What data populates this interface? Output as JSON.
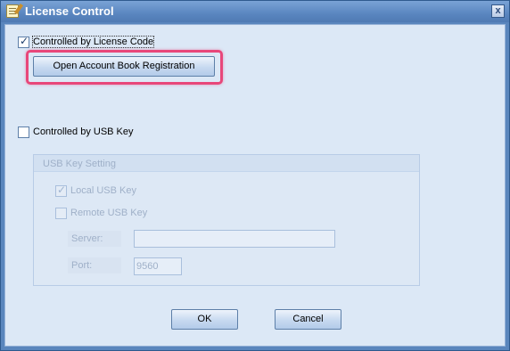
{
  "window": {
    "title": "License Control",
    "close_glyph": "x"
  },
  "license_code": {
    "checkbox_label": "Controlled by License Code",
    "checked": true,
    "register_button": "Open Account Book Registration"
  },
  "usb_key": {
    "checkbox_label": "Controlled by USB Key",
    "checked": false,
    "group_title": "USB Key Setting",
    "local_label": "Local USB Key",
    "local_checked": true,
    "remote_label": "Remote USB Key",
    "remote_checked": false,
    "server_label": "Server:",
    "server_value": "",
    "port_label": "Port:",
    "port_value": "9560"
  },
  "actions": {
    "ok_label": "OK",
    "cancel_label": "Cancel"
  },
  "colors": {
    "highlight": "#e8477a",
    "title_bar": "#5a86c0"
  },
  "icons": [
    "notepad-icon",
    "close-icon",
    "checkmark-icon"
  ]
}
